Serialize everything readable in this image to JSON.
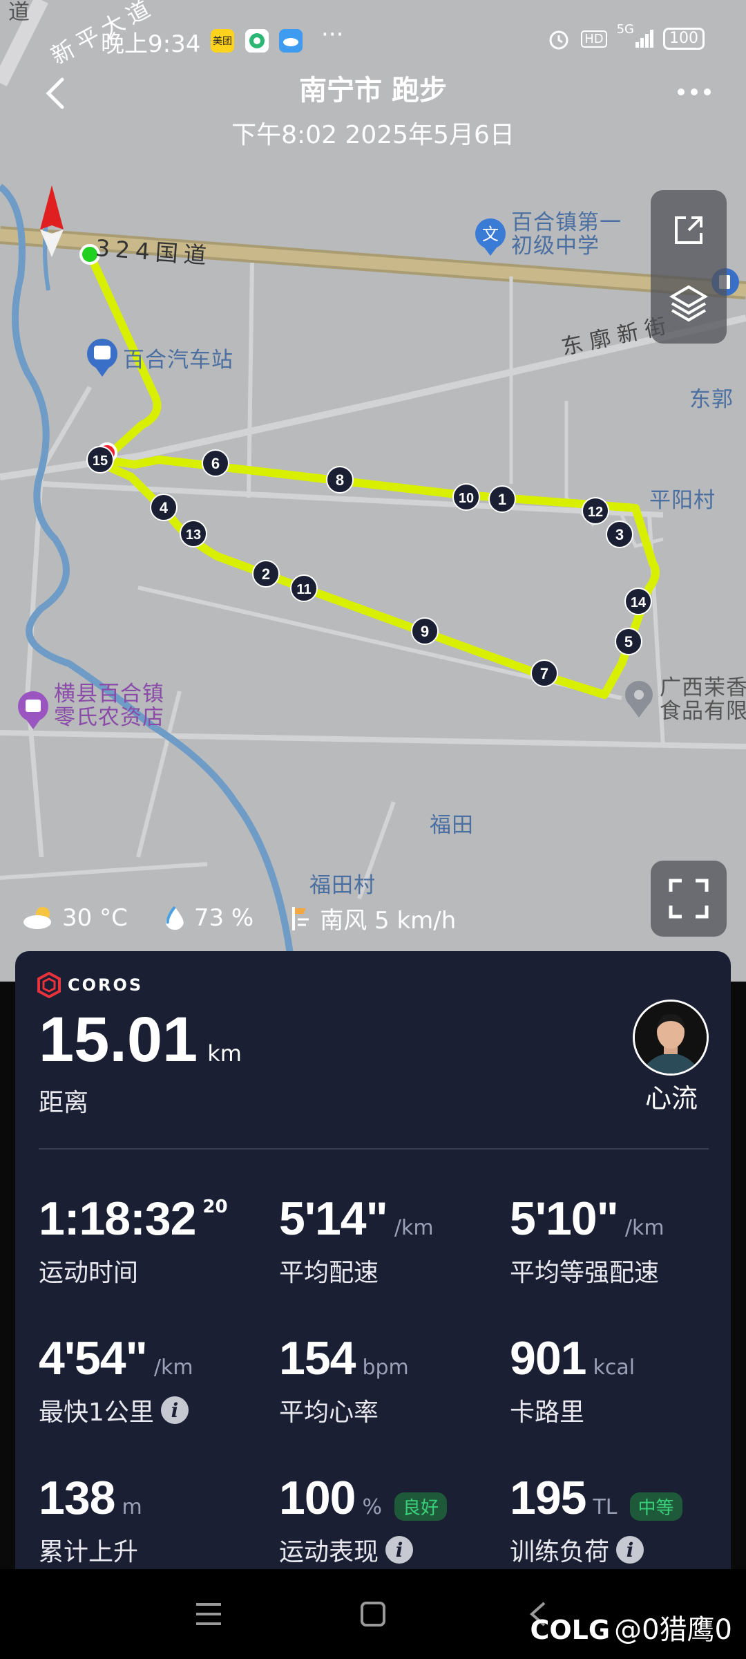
{
  "status_bar": {
    "time": "晚上9:34",
    "app_icons": [
      "meituan-icon",
      "app-green-icon",
      "app-cloud-icon"
    ],
    "app_meituan_label": "美团",
    "more": "···",
    "hd": "HD",
    "network": "5G",
    "battery": "100"
  },
  "header": {
    "title": "南宁市 跑步",
    "subtitle": "下午8:02 2025年5月6日"
  },
  "map": {
    "labels": {
      "road_xinping": "新平大道",
      "top_left_edge": "道",
      "road_324": "324国道",
      "school": "百合镇第一\n初级中学",
      "school_line1": "百合镇第一",
      "school_line2": "初级中学",
      "bus_station": "百合汽车站",
      "dongmiao": "东廓新街",
      "donguo": "东郭",
      "pingyang": "平阳村",
      "guangxi_line1": "广西茉香",
      "guangxi_line2": "食品有限",
      "shop_line1": "横县百合镇",
      "shop_line2": "零氏农资店",
      "futian": "福田",
      "futian_village": "福田村"
    },
    "km_markers": [
      "1",
      "2",
      "3",
      "4",
      "5",
      "6",
      "7",
      "8",
      "9",
      "10",
      "11",
      "12",
      "13",
      "14",
      "15"
    ],
    "route_color": "#d8f000",
    "start_color": "#22d022",
    "end_color": "#ee2233"
  },
  "weather": {
    "temp": "30 °C",
    "humidity": "73 %",
    "wind": "南风 5 km/h"
  },
  "card": {
    "brand": "COROS",
    "distance_value": "15.01",
    "distance_unit": "km",
    "distance_label": "距离",
    "user_name": "心流",
    "stats": [
      {
        "value": "1:18:32",
        "sup": "20",
        "unit": "",
        "label": "运动时间"
      },
      {
        "value": "5'14\"",
        "unit": "/km",
        "label": "平均配速"
      },
      {
        "value": "5'10\"",
        "unit": "/km",
        "label": "平均等强配速"
      },
      {
        "value": "4'54\"",
        "unit": "/km",
        "label": "最快1公里"
      },
      {
        "value": "154",
        "unit": "bpm",
        "label": "平均心率"
      },
      {
        "value": "901",
        "unit": "kcal",
        "label": "卡路里"
      },
      {
        "value": "138",
        "unit": "m",
        "label": "累计上升"
      },
      {
        "value": "100",
        "unit": "%",
        "badge": "良好",
        "label": "运动表现"
      },
      {
        "value": "195",
        "unit": "TL",
        "badge": "中等",
        "label": "训练负荷"
      }
    ]
  },
  "watermark": {
    "brand": "COLG",
    "user": "@0猎鹰0"
  }
}
